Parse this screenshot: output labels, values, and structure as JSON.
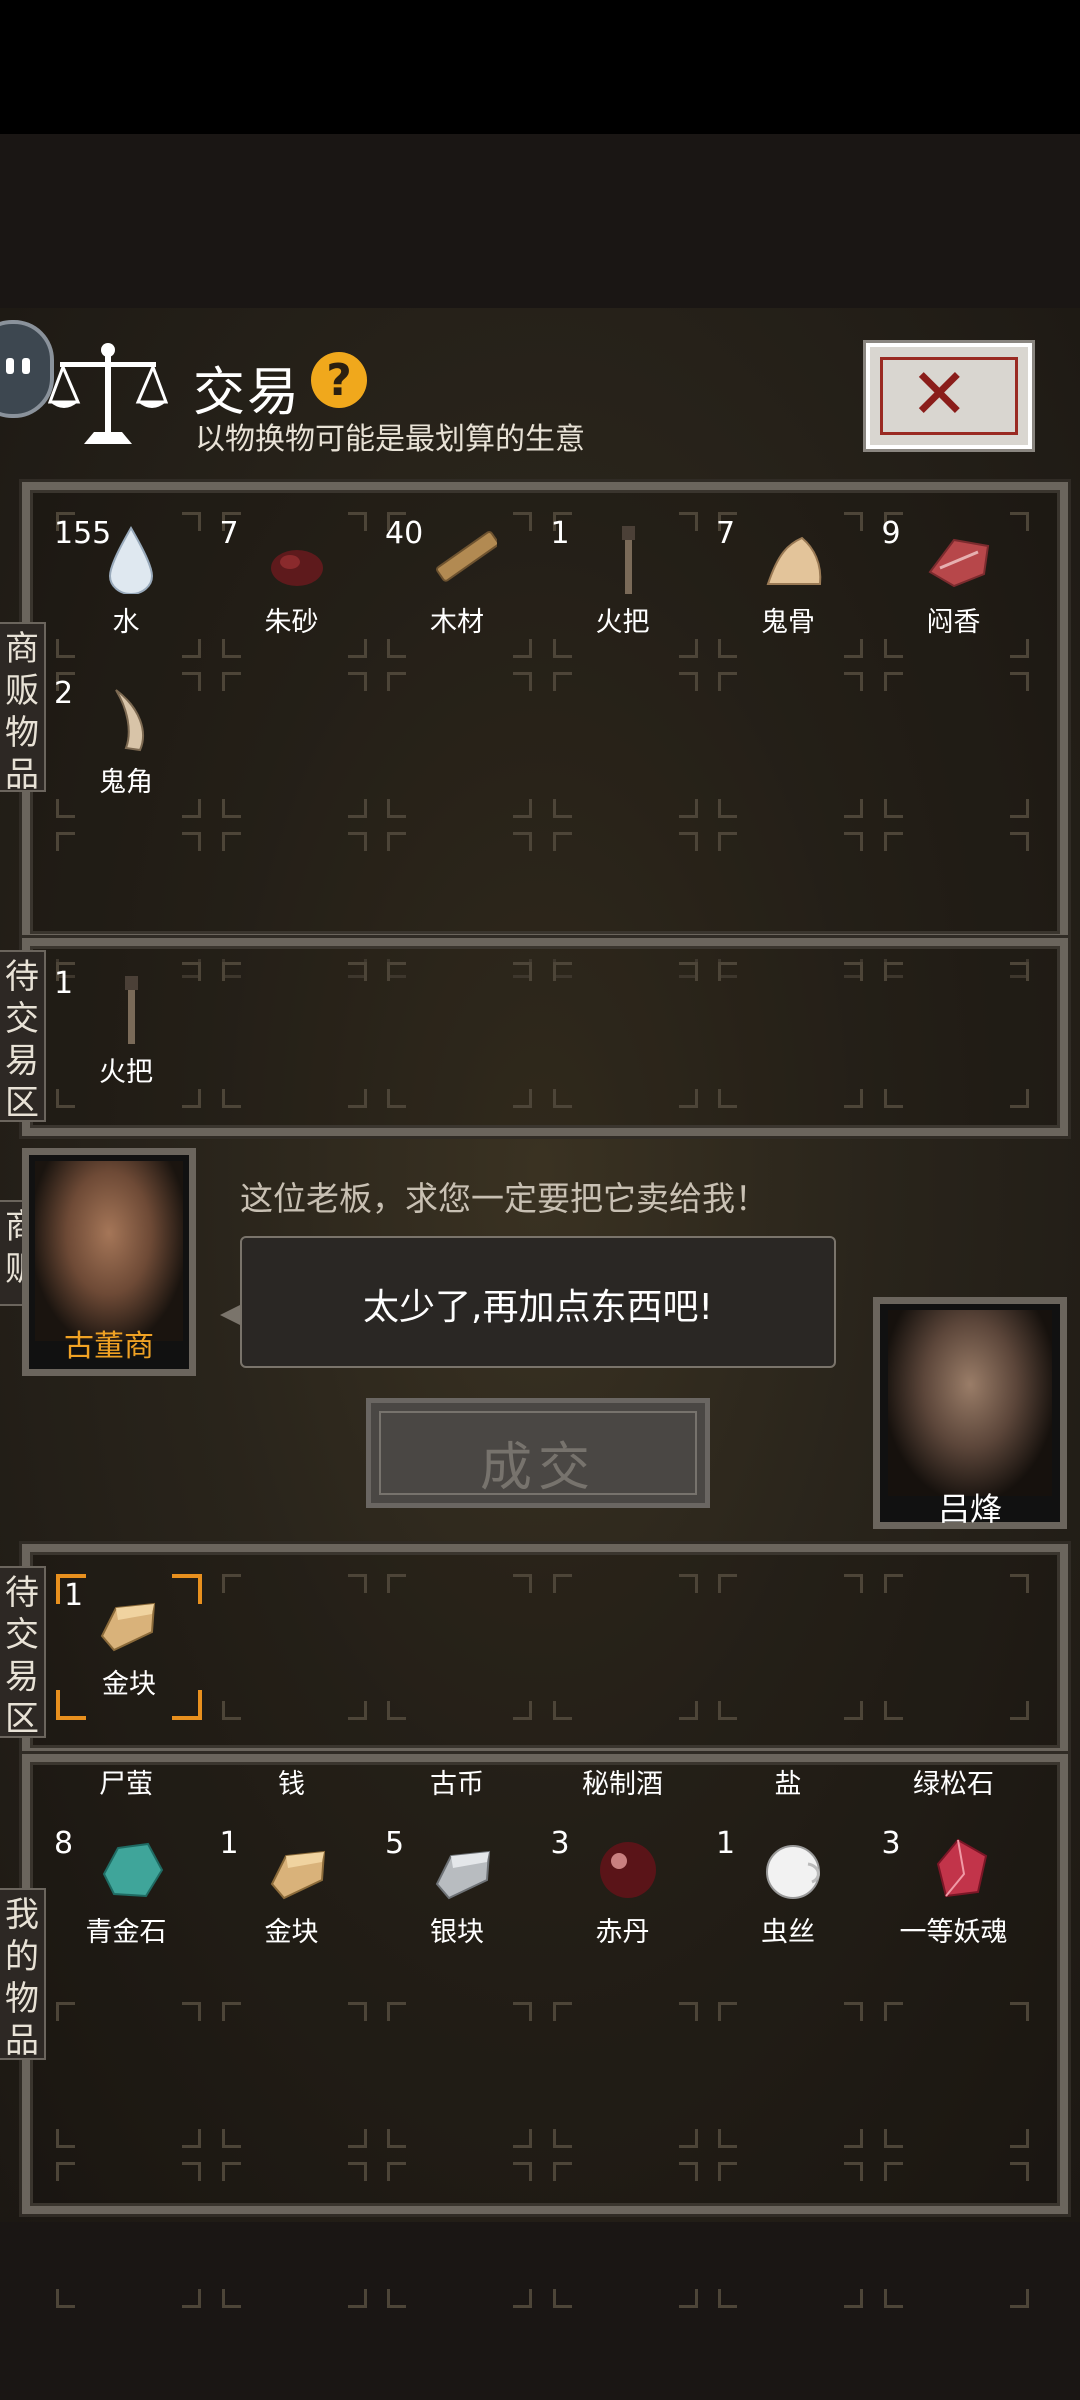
{
  "header": {
    "title": "交易",
    "help_symbol": "?",
    "subtitle": "以物换物可能是最划算的生意",
    "close_symbol": "✕"
  },
  "tabs": {
    "merchant_goods": "商\n贩\n物\n品",
    "pending_trade_merchant": "待\n交\n易\n区",
    "merchant": "商\n贩",
    "pending_trade_mine": "待\n交\n易\n区",
    "my_goods": "我\n的\n物\n品"
  },
  "merchant_goods": [
    {
      "count": "155",
      "label": "水",
      "icon": "water-drop-icon"
    },
    {
      "count": "7",
      "label": "朱砂",
      "icon": "cinnabar-icon"
    },
    {
      "count": "40",
      "label": "木材",
      "icon": "wood-icon"
    },
    {
      "count": "1",
      "label": "火把",
      "icon": "torch-icon"
    },
    {
      "count": "7",
      "label": "鬼骨",
      "icon": "ghost-bone-icon"
    },
    {
      "count": "9",
      "label": "闷香",
      "icon": "incense-meat-icon"
    },
    {
      "count": "2",
      "label": "鬼角",
      "icon": "ghost-horn-icon"
    }
  ],
  "merchant_pending": [
    {
      "count": "1",
      "label": "火把",
      "icon": "torch-icon"
    }
  ],
  "merchant": {
    "name": "古董商",
    "dialog": "这位老板，求您一定要把它卖给我！",
    "speech": "太少了,再加点东西吧!"
  },
  "deal_button": "成交",
  "player": {
    "name": "吕烽"
  },
  "my_pending": [
    {
      "count": "1",
      "label": "金块",
      "icon": "gold-bar-icon"
    }
  ],
  "my_goods_names_row": [
    "尸萤",
    "钱",
    "古币",
    "秘制酒",
    "盐",
    "绿松石"
  ],
  "my_goods": [
    {
      "count": "8",
      "label": "青金石",
      "icon": "lapis-stone-icon"
    },
    {
      "count": "1",
      "label": "金块",
      "icon": "gold-bar-icon"
    },
    {
      "count": "5",
      "label": "银块",
      "icon": "silver-bar-icon"
    },
    {
      "count": "3",
      "label": "赤丹",
      "icon": "red-pill-icon"
    },
    {
      "count": "1",
      "label": "虫丝",
      "icon": "silk-icon"
    },
    {
      "count": "3",
      "label": "一等妖魂",
      "icon": "demon-soul-crystal-icon"
    }
  ],
  "colors": {
    "accent": "#f0a224",
    "selection": "#e8901e",
    "frame": "#6b655d"
  }
}
